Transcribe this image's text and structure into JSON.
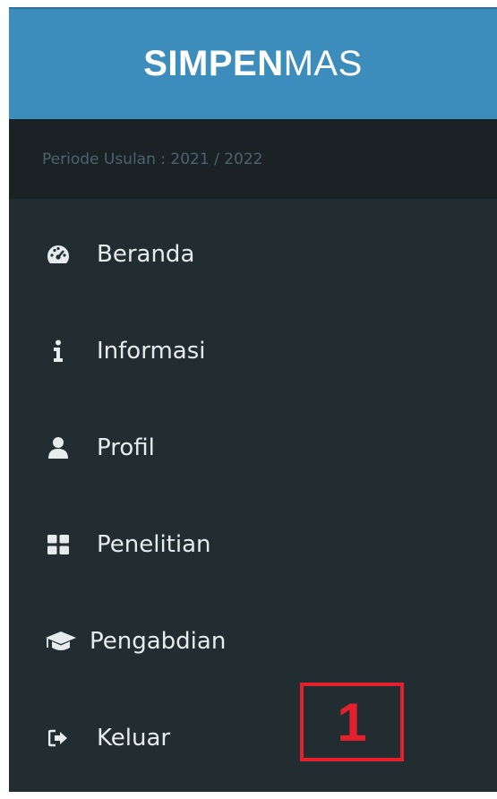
{
  "brand": {
    "bold_part": "SIMPEN",
    "light_part": "MAS"
  },
  "period": {
    "text": "Periode Usulan : 2021 / 2022"
  },
  "menu": {
    "items": [
      {
        "label": "Beranda",
        "icon": "dashboard-icon"
      },
      {
        "label": "Informasi",
        "icon": "info-icon"
      },
      {
        "label": "Profil",
        "icon": "user-icon"
      },
      {
        "label": "Penelitian",
        "icon": "grid-icon"
      },
      {
        "label": "Pengabdian",
        "icon": "graduation-cap-icon"
      },
      {
        "label": "Keluar",
        "icon": "sign-out-icon"
      }
    ]
  },
  "annotation": {
    "number": "1",
    "color": "#e3202b"
  },
  "colors": {
    "header_bg": "#3c8dbc",
    "sidebar_bg": "#222d32",
    "period_bg": "#1a2226"
  }
}
